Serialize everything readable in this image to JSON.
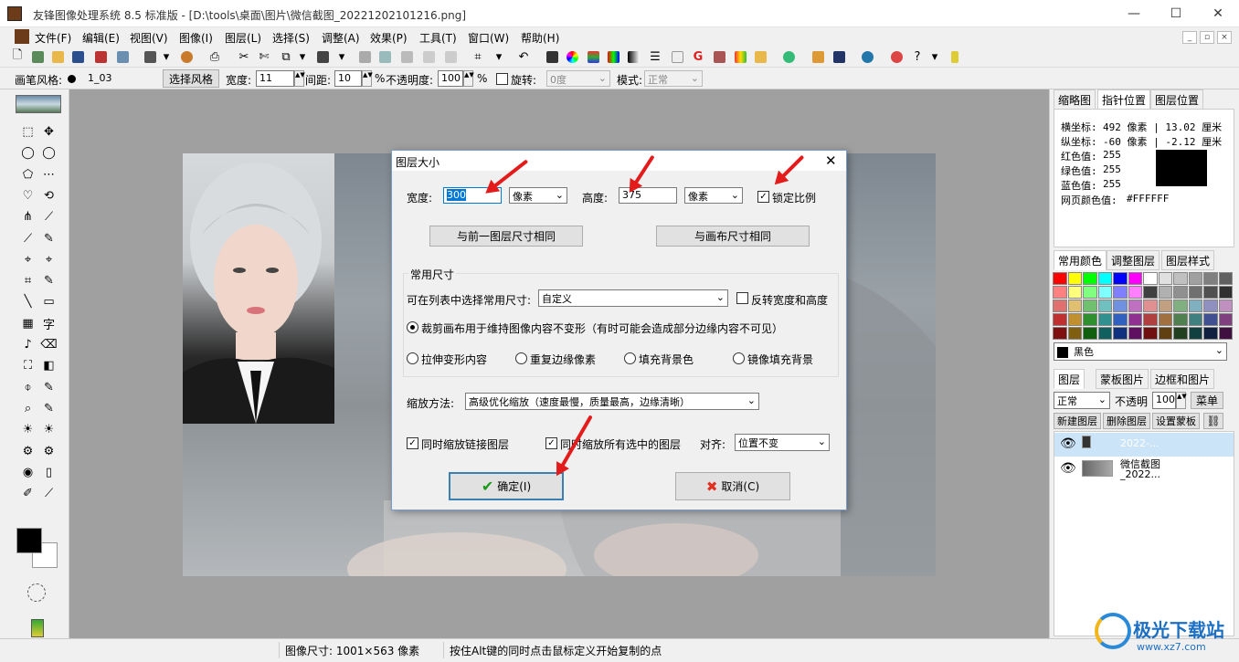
{
  "app": {
    "title": "友锋图像处理系统 8.5 标准版 - [D:\\tools\\桌面\\图片\\微信截图_20221202101216.png]",
    "win_minimize": "—",
    "win_maximize": "☐",
    "win_close": "✕"
  },
  "menu": [
    "文件(F)",
    "编辑(E)",
    "视图(V)",
    "图像(I)",
    "图层(L)",
    "选择(S)",
    "调整(A)",
    "效果(P)",
    "工具(T)",
    "窗口(W)",
    "帮助(H)"
  ],
  "options_bar": {
    "brush_style_label": "画笔风格:",
    "brush_name": "1_03",
    "select_style_btn": "选择风格",
    "width_label": "宽度:",
    "width_value": "11",
    "spacing_label": "间距:",
    "spacing_value": "10",
    "percent": "%",
    "opacity_label": "不透明度:",
    "opacity_value": "100",
    "rotate_label": "旋转:",
    "rotate_value": "0度",
    "mode_label": "模式:",
    "mode_value": "正常"
  },
  "dialog": {
    "title": "图层大小",
    "close": "✕",
    "width_label": "宽度:",
    "width_value": "300",
    "height_label": "高度:",
    "height_value": "375",
    "unit": "像素",
    "unit2": "像素",
    "lock_ratio": "锁定比例",
    "same_prev_layer": "与前一图层尺寸相同",
    "same_canvas": "与画布尺寸相同",
    "common_size_group": "常用尺寸",
    "choose_size_label": "可在列表中选择常用尺寸:",
    "choose_size_value": "自定义",
    "swap_wh": "反转宽度和高度",
    "opt_crop": "裁剪画布用于维持图像内容不变形（有时可能会造成部分边缘内容不可见）",
    "opt_stretch": "拉伸变形内容",
    "opt_repeat": "重复边缘像素",
    "opt_fill_bg": "填充背景色",
    "opt_mirror": "镜像填充背景",
    "scale_method_label": "缩放方法:",
    "scale_method_value": "高级优化缩放（速度最慢，质量最高，边缘清晰）",
    "scale_linked": "同时缩放链接图层",
    "scale_selected": "同时缩放所有选中的图层",
    "align_label": "对齐:",
    "align_value": "位置不变",
    "ok": "确定(I)",
    "cancel": "取消(C)"
  },
  "right_panel": {
    "tabs_top": [
      "缩略图",
      "指针位置",
      "图层位置"
    ],
    "pointer": {
      "x_label": "横坐标:",
      "x_value": "492 像素 | 13.02 厘米",
      "y_label": "纵坐标:",
      "y_value": "-60 像素 | -2.12 厘米",
      "r_label": "红色值:",
      "r_value": "255",
      "g_label": "绿色值:",
      "g_value": "255",
      "b_label": "蓝色值:",
      "b_value": "255",
      "web_label": "网页颜色值:",
      "web_value": "#FFFFFF"
    },
    "tabs_mid": [
      "常用颜色",
      "调整图层",
      "图层样式"
    ],
    "color_select": "黑色",
    "tabs_layers": [
      "图层",
      "蒙板图片",
      "边框和图片"
    ],
    "blend_mode": "正常",
    "opacity_label": "不透明",
    "opacity_value": "100",
    "menu_btn": "菜单",
    "new_layer": "新建图层",
    "delete_layer": "删除图层",
    "set_mask": "设置蒙板",
    "layers": [
      {
        "name": "2022-..."
      },
      {
        "name": "微信截图",
        "name2": "_2022..."
      }
    ]
  },
  "status": {
    "image_size": "图像尺寸: 1001×563 像素",
    "hint": "按住Alt键的同时点击鼠标定义开始复制的点"
  },
  "watermark": {
    "brand": "极光下载站",
    "url": "www.xz7.com"
  },
  "colors": {
    "accent_red": "#e31b1b",
    "ok_border": "#3c7fb1",
    "selection_blue": "#cce4f7"
  }
}
